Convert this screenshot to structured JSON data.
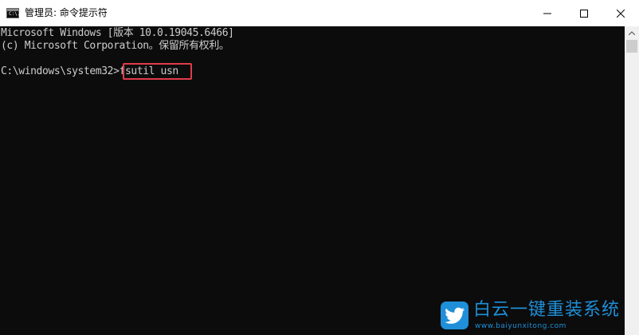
{
  "window": {
    "title": "管理员: 命令提示符",
    "icon_name": "cmd-app-icon",
    "icon_text": "C:\\."
  },
  "console": {
    "lines": [
      "Microsoft Windows [版本 10.0.19045.6466]",
      "(c) Microsoft Corporation。保留所有权利。",
      "",
      "C:\\windows\\system32>fsutil usn"
    ],
    "prompt": "C:\\windows\\system32>",
    "command": "fsutil usn",
    "highlight_color": "#e03c4a",
    "text_color": "#cccccc",
    "background_color": "#0c0c0c"
  },
  "watermark": {
    "title": "白云一键重装系统",
    "url": "www.baiyunxitong.com",
    "color": "#1e8fd8"
  }
}
